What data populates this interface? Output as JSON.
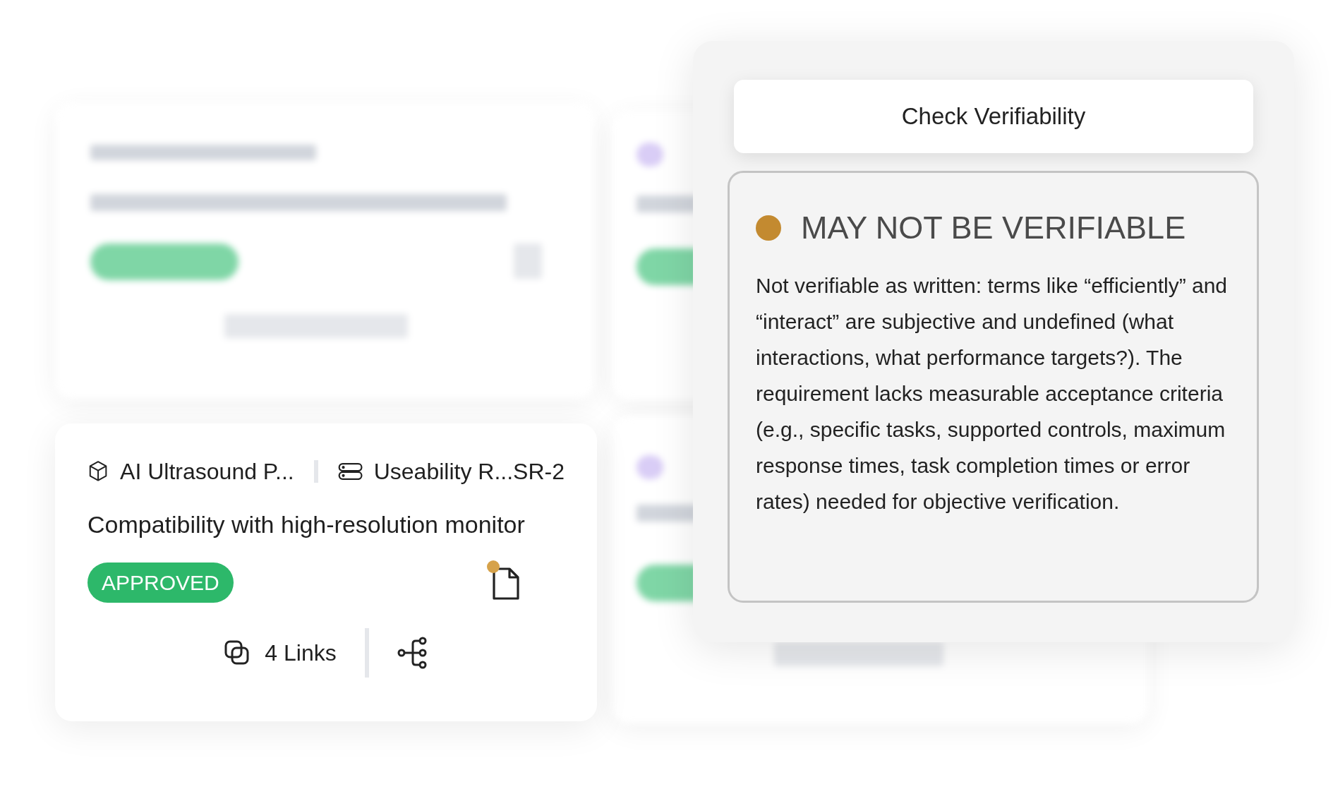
{
  "card": {
    "project": "AI Ultrasound P...",
    "requirement": "Useability R...SR-2",
    "title": "Compatibility with high-resolution monitor",
    "status": "APPROVED",
    "document_flag": true,
    "links": "4 Links"
  },
  "verifiability": {
    "button": "Check Verifiability",
    "result": {
      "color": "#c38a30",
      "heading": "MAY NOT BE VERIFIABLE",
      "text": "Not verifiable as written: terms like “efficiently” and “interact” are subjective and undefined (what interactions, what performance targets?). The requirement lacks measurable acceptance criteria (e.g., specific tasks, supported controls, maximum response times, task completion times or error rates) needed for objective verification."
    }
  }
}
